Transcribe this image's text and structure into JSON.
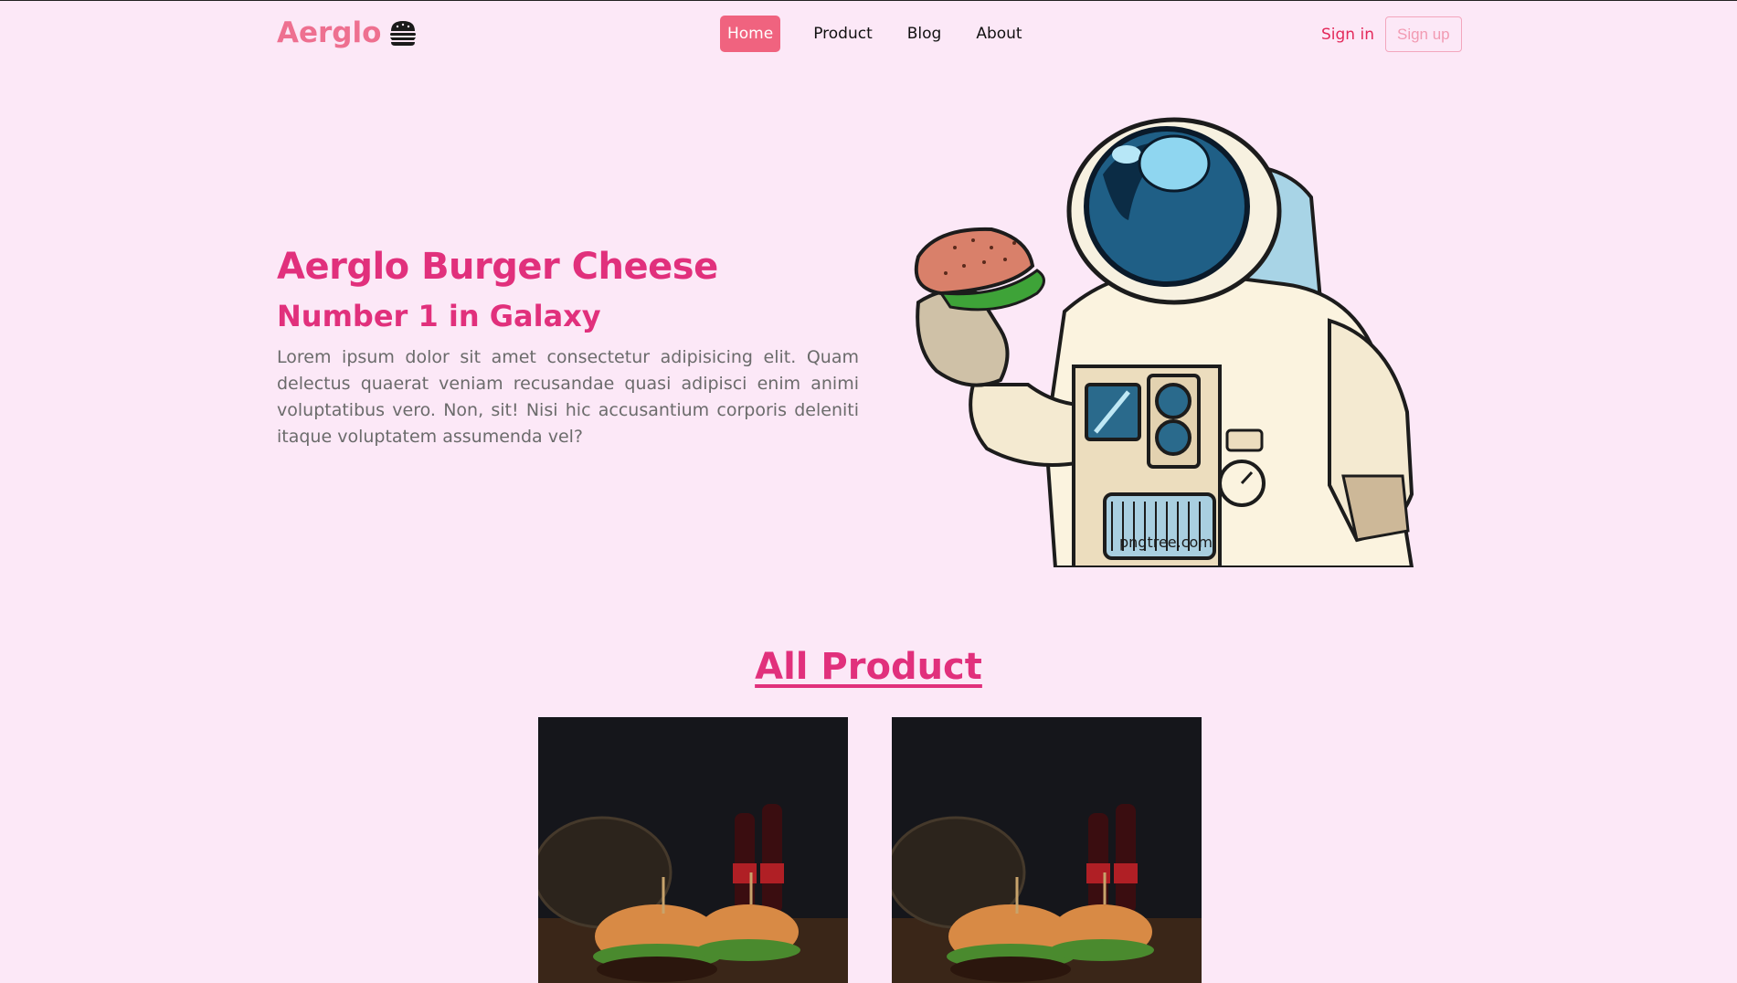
{
  "navbar": {
    "brand": "Aerglo",
    "brand_icon": "burger-icon",
    "links": [
      {
        "label": "Home",
        "active": true
      },
      {
        "label": "Product",
        "active": false
      },
      {
        "label": "Blog",
        "active": false
      },
      {
        "label": "About",
        "active": false
      }
    ],
    "signin_label": "Sign in",
    "signup_label": "Sign up"
  },
  "hero": {
    "title": "Aerglo Burger Cheese",
    "subtitle": "Number 1 in Galaxy",
    "description": "Lorem ipsum dolor sit amet consectetur adipisicing elit. Quam delectus quaerat veniam recusandae quasi adipisci enim animi voluptatibus vero. Non, sit! Nisi hic accusantium corporis deleniti itaque voluptatem assumenda vel?",
    "illustration": "astronaut-holding-burger",
    "watermark": "pngtree.com"
  },
  "products": {
    "title": "All Product",
    "items": [
      {
        "image": "burger-with-cola-photo"
      },
      {
        "image": "burger-with-cola-photo"
      }
    ]
  },
  "colors": {
    "background": "#fce8f7",
    "accent": "#e1307c",
    "brand": "#ee7090",
    "active_nav": "#f0637f"
  }
}
